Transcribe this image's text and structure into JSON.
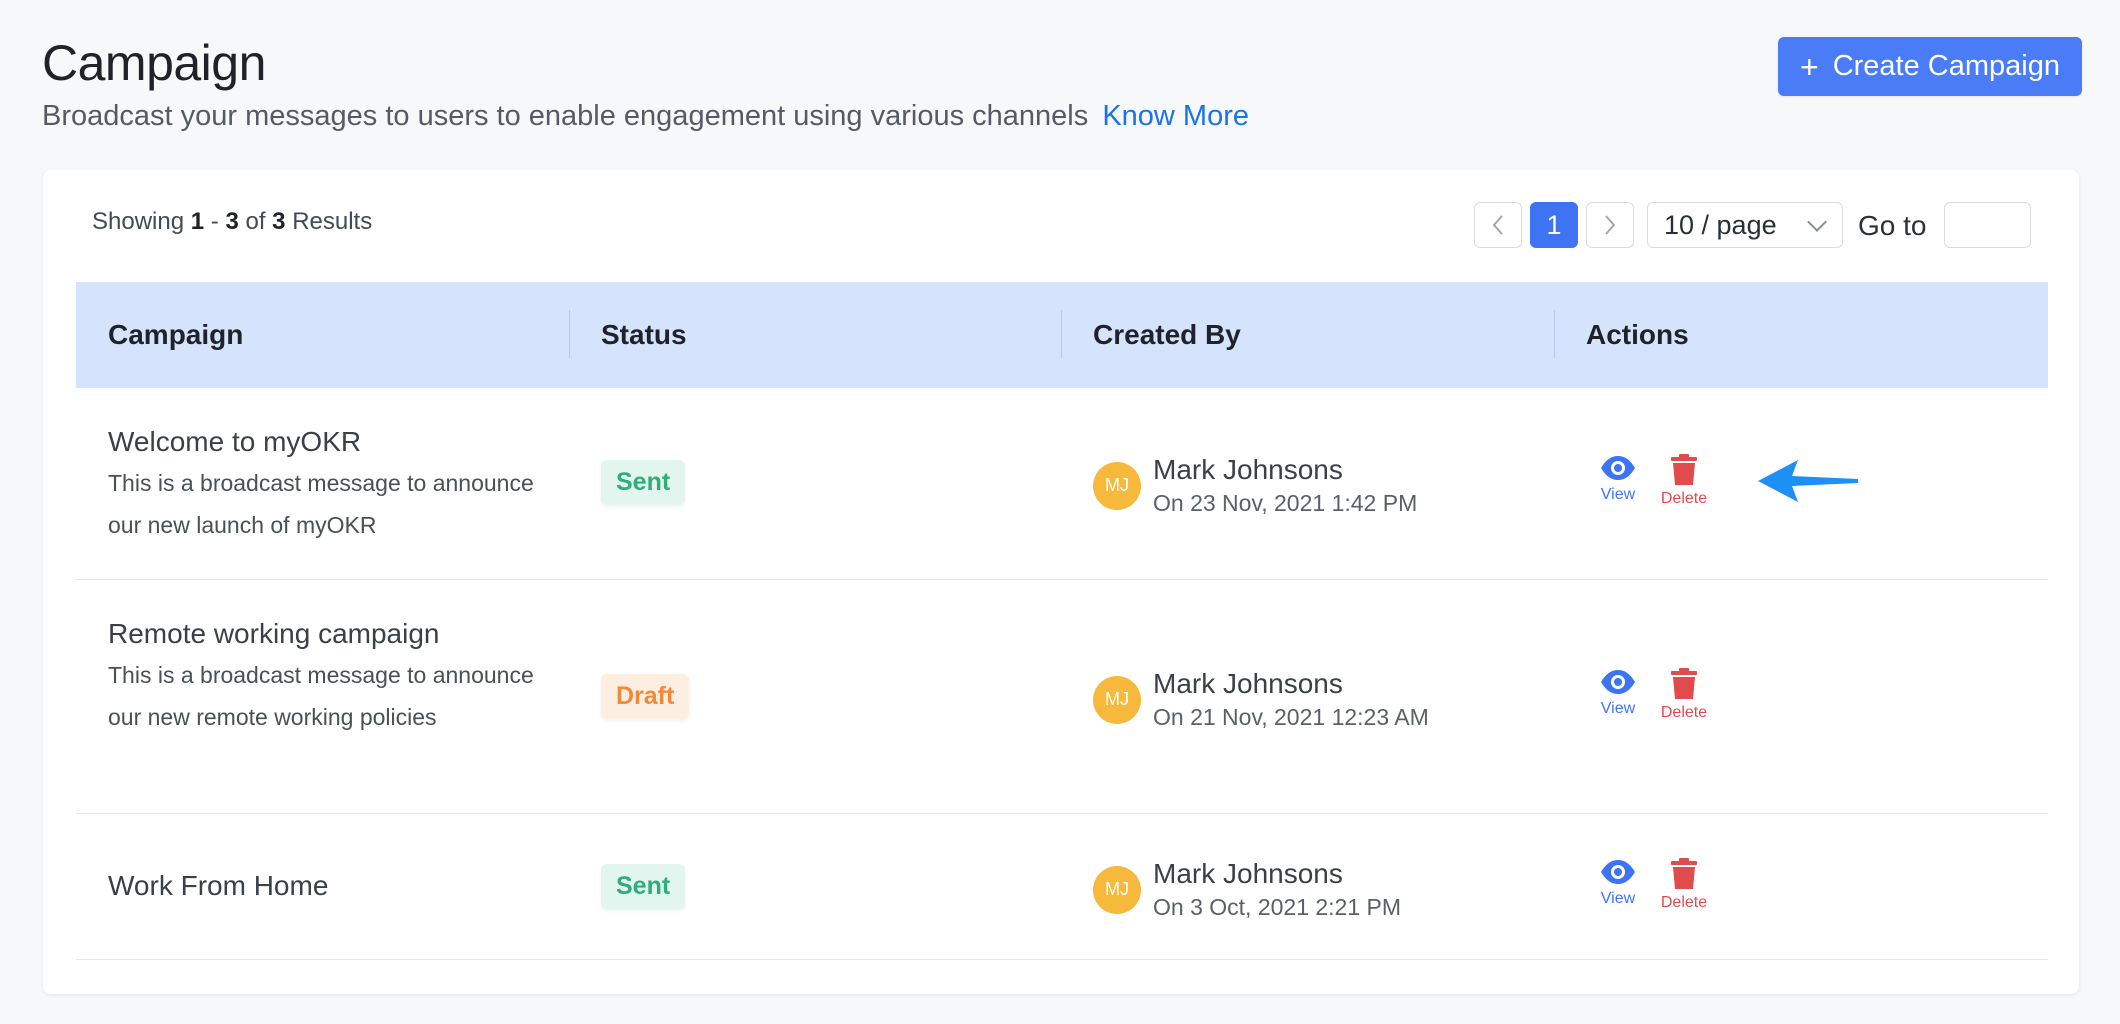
{
  "header": {
    "title": "Campaign",
    "subtitle": "Broadcast your messages to users to enable engagement using various channels",
    "know_more": "Know More",
    "create_button": "Create Campaign"
  },
  "results": {
    "prefix": "Showing",
    "from": "1",
    "dash": "-",
    "to": "3",
    "of": "of",
    "total": "3",
    "suffix": "Results"
  },
  "pagination": {
    "prev": "<",
    "current_page": "1",
    "next": ">",
    "page_size": "10 / page",
    "goto_label": "Go to"
  },
  "table": {
    "columns": [
      "Campaign",
      "Status",
      "Created By",
      "Actions"
    ],
    "rows": [
      {
        "title": "Welcome to myOKR",
        "description": "This is a broadcast message to announce our new launch of myOKR",
        "status": "Sent",
        "creator_initials": "MJ",
        "creator_name": "Mark Johnsons",
        "created_on": "On 23 Nov, 2021 1:42 PM",
        "view_label": "View",
        "delete_label": "Delete"
      },
      {
        "title": "Remote working campaign",
        "description": "This is a broadcast message to announce our new remote working policies",
        "status": "Draft",
        "creator_initials": "MJ",
        "creator_name": "Mark Johnsons",
        "created_on": "On 21 Nov, 2021 12:23 AM",
        "view_label": "View",
        "delete_label": "Delete"
      },
      {
        "title": "Work From Home",
        "description": "",
        "status": "Sent",
        "creator_initials": "MJ",
        "creator_name": "Mark Johnsons",
        "created_on": "On 3 Oct, 2021 2:21 PM",
        "view_label": "View",
        "delete_label": "Delete"
      }
    ]
  },
  "colors": {
    "primary": "#3e74f4",
    "header_bg": "#d5e4fc",
    "sent": "#2fae7b",
    "draft": "#f08a3a",
    "delete": "#e04c4c",
    "avatar": "#f6b93b",
    "annotation_arrow": "#1e90f5"
  },
  "icons": {
    "view": "eye-icon",
    "delete": "trash-icon",
    "annotation": "pointer-arrow-icon"
  }
}
